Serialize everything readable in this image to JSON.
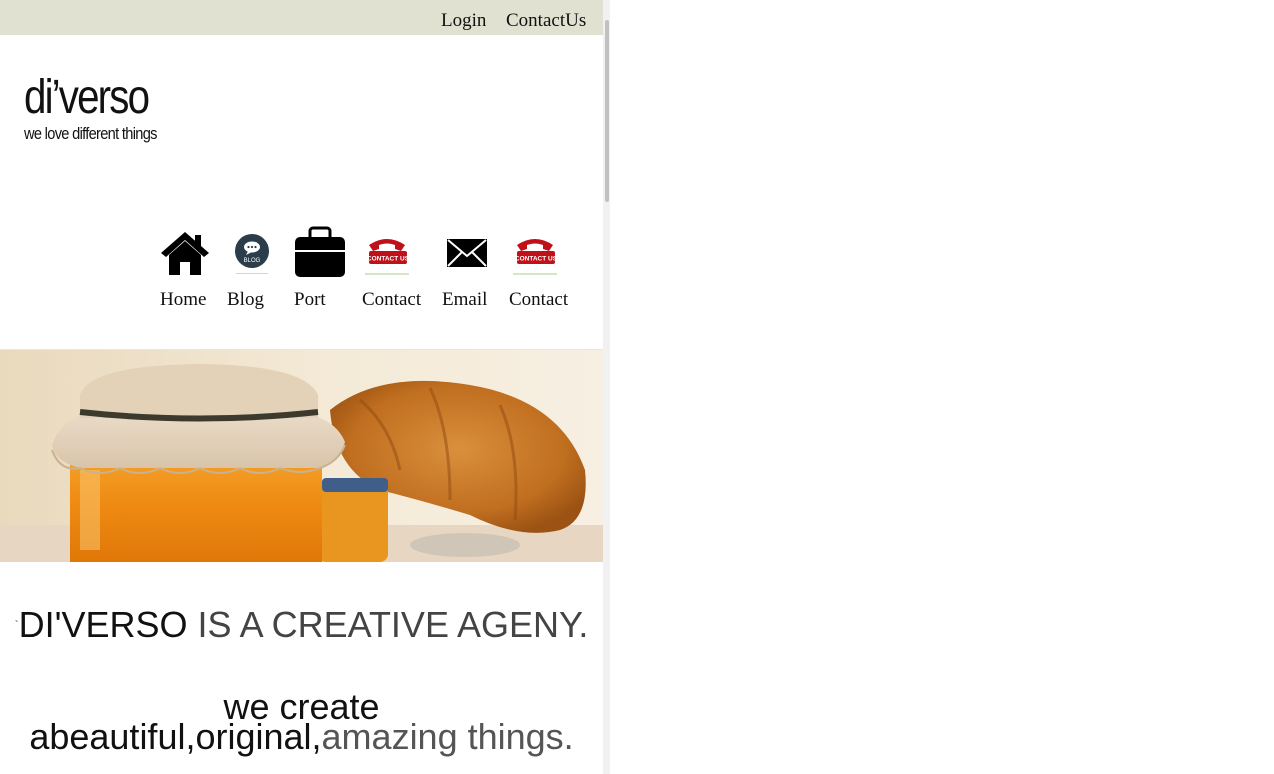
{
  "topbar": {
    "login_label": "Login",
    "contact_label": "ContactUs"
  },
  "logo": {
    "name": "di’verso",
    "tagline": "we love different things"
  },
  "nav": [
    {
      "label": "Home",
      "icon": "home-icon"
    },
    {
      "label": "Blog",
      "icon": "blog-icon",
      "badge": "BLOG"
    },
    {
      "label": "Port",
      "icon": "briefcase-icon"
    },
    {
      "label": "Contact",
      "icon": "contact-phone-icon",
      "badge": "CONTACT US"
    },
    {
      "label": "Email",
      "icon": "envelope-icon"
    },
    {
      "label": "Contact",
      "icon": "contact-phone-icon",
      "badge": "CONTACT US"
    }
  ],
  "headline": {
    "tick": "`",
    "brand": "DI'VERSO",
    "rest": " IS A CREATIVE AGENY."
  },
  "tagline": {
    "line1": "we create",
    "line2_dark": "abeautiful,original,",
    "line2_light": "amazing things."
  },
  "colors": {
    "topbar_bg": "#e1e1d2",
    "text": "#111111",
    "muted": "#555555",
    "contact_red": "#c0101a"
  }
}
